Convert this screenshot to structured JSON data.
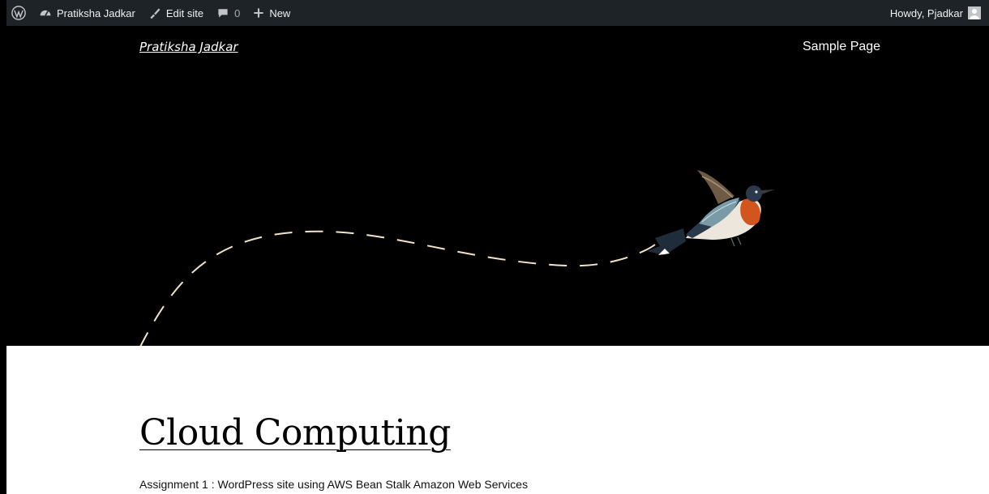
{
  "adminbar": {
    "site_name": "Pratiksha Jadkar",
    "edit_site": "Edit site",
    "comments_count": "0",
    "new_label": "New",
    "howdy": "Howdy, Pjadkar"
  },
  "hero": {
    "site_title": "Pratiksha Jadkar",
    "nav_item": "Sample Page"
  },
  "post": {
    "title": "Cloud Computing",
    "excerpt": "Assignment 1 :  WordPress site using AWS Bean Stalk Amazon Web Services"
  },
  "colors": {
    "admin_bar": "#1d2327",
    "hero_bg": "#000000",
    "dash_line": "#f3e4c9"
  }
}
